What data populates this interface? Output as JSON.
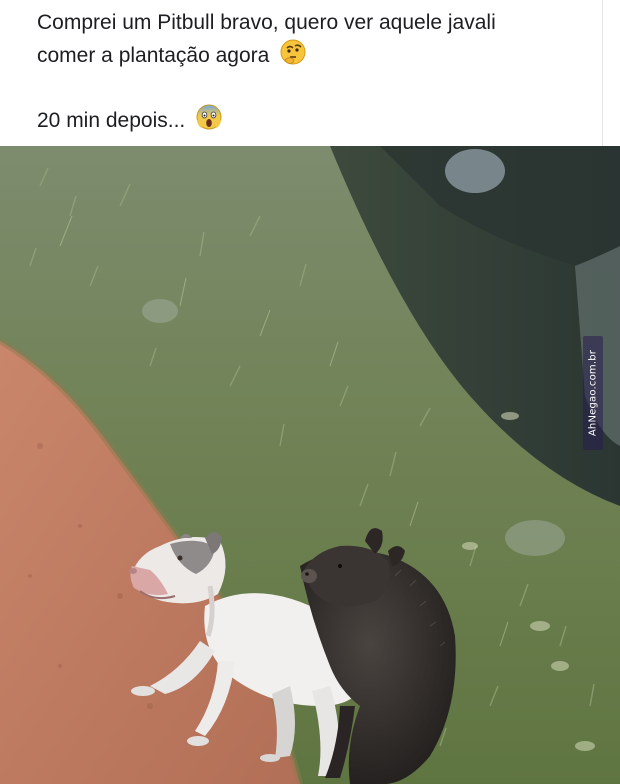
{
  "post": {
    "line1": "Comprei um Pitbull bravo, quero ver aquele javali",
    "line2": "comer a plantação agora",
    "line3": "20 min depois...",
    "emoji1": "thinking-face",
    "emoji2": "face-screaming-in-fear"
  },
  "photo": {
    "description_icon": "photo",
    "watermark": "AhNegao.com.br"
  }
}
